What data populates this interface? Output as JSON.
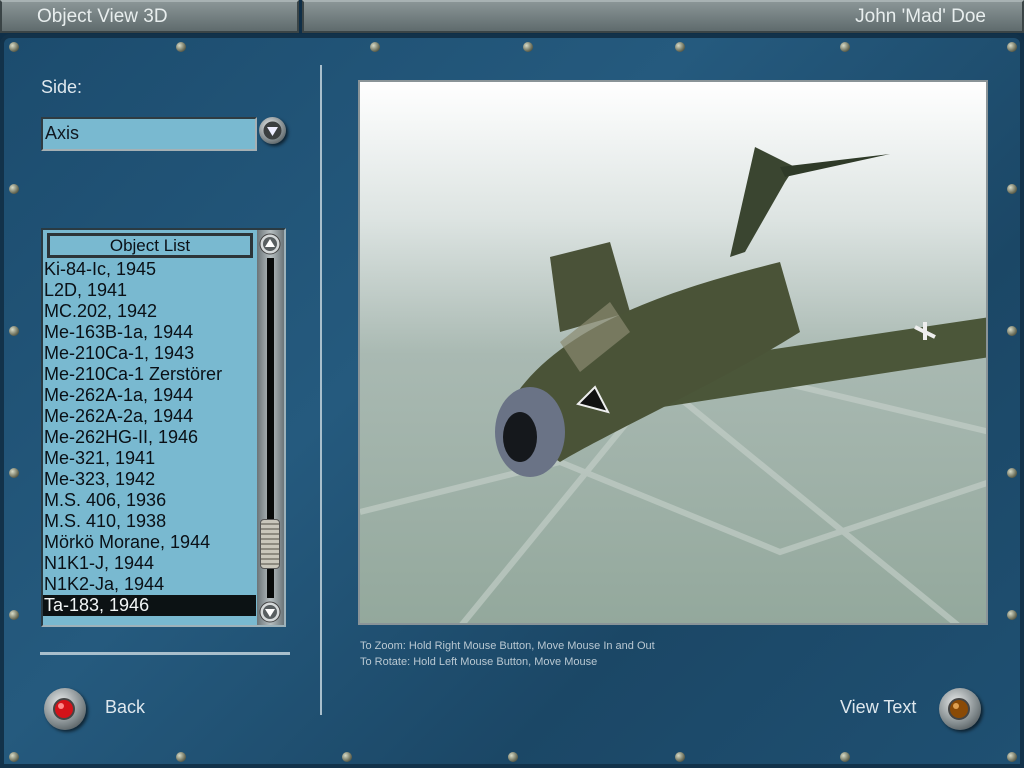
{
  "window": {
    "title": "Object View 3D",
    "user": "John 'Mad' Doe"
  },
  "side": {
    "label": "Side:",
    "value": "Axis"
  },
  "object_list": {
    "header": "Object List",
    "selected_index": 16,
    "scroll_position": 0.9,
    "items": [
      "Ki-84-Ic, 1945",
      "L2D, 1941",
      "MC.202, 1942",
      "Me-163B-1a, 1944",
      "Me-210Ca-1, 1943",
      "Me-210Ca-1 Zerstörer",
      "Me-262A-1a, 1944",
      "Me-262A-2a, 1944",
      "Me-262HG-II, 1946",
      "Me-321, 1941",
      "Me-323, 1942",
      "M.S. 406, 1936",
      "M.S. 410, 1938",
      "Mörkö Morane, 1944",
      "N1K1-J, 1944",
      "N1K2-Ja, 1944",
      "Ta-183, 1946"
    ]
  },
  "help": {
    "zoom": "To Zoom: Hold Right Mouse Button, Move Mouse In and Out",
    "rotate": "To Rotate: Hold Left Mouse Button, Move Mouse"
  },
  "buttons": {
    "back": "Back",
    "view_text": "View Text"
  },
  "colors": {
    "panel": "#1f5072",
    "field": "#79b9d0",
    "back_lamp": "#d41218",
    "view_text_lamp": "#8a4a06"
  }
}
